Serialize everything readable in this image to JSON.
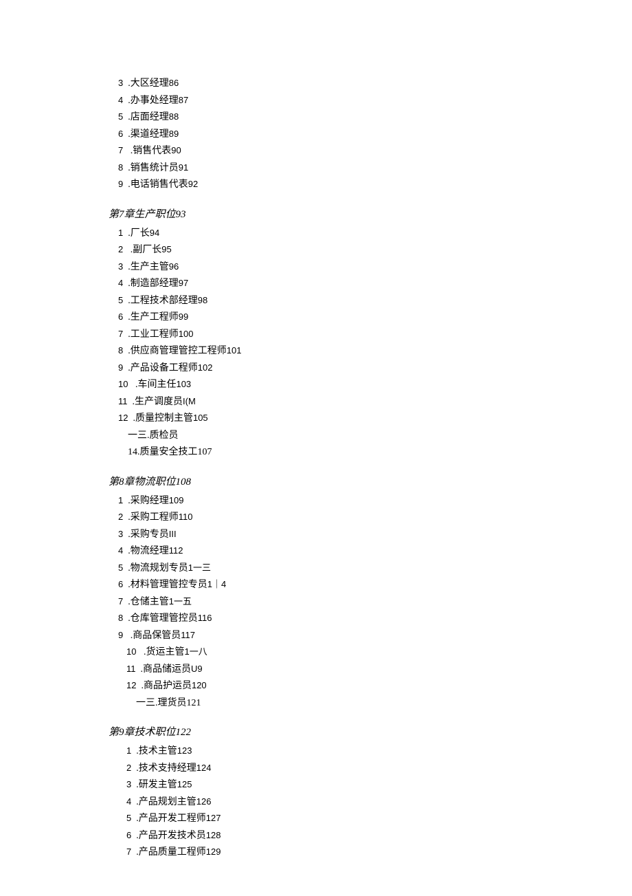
{
  "sections": [
    {
      "heading": null,
      "items": [
        {
          "num": "3",
          "sep": "  .",
          "text": "大区经理",
          "page": "86"
        },
        {
          "num": "4",
          "sep": "  .",
          "text": "办事处经理",
          "page": "87"
        },
        {
          "num": "5",
          "sep": "  .",
          "text": "店面经理",
          "page": "88"
        },
        {
          "num": "6",
          "sep": "  .",
          "text": "渠道经理",
          "page": "89"
        },
        {
          "num": "7",
          "sep": "   .",
          "text": "销售代表",
          "page": "90"
        },
        {
          "num": "8",
          "sep": "  .",
          "text": "销售统计员",
          "page": "91"
        },
        {
          "num": "9",
          "sep": "  .",
          "text": "电话销售代表",
          "page": "92"
        }
      ]
    },
    {
      "heading": {
        "prefix": "第",
        "num": "7",
        "title": "章生产职位",
        "page": "93"
      },
      "items": [
        {
          "num": "1",
          "sep": "  .",
          "text": "厂长",
          "page": "94"
        },
        {
          "num": "2",
          "sep": "   .",
          "text": "副厂长",
          "page": "95"
        },
        {
          "num": "3",
          "sep": "  .",
          "text": "生产主管",
          "page": "96"
        },
        {
          "num": "4",
          "sep": "  .",
          "text": "制造部经理",
          "page": "97"
        },
        {
          "num": "5",
          "sep": "  .",
          "text": "工程技术部经理",
          "page": "98"
        },
        {
          "num": "6",
          "sep": "  .",
          "text": "生产工程师",
          "page": "99"
        },
        {
          "num": "7",
          "sep": "  .",
          "text": "工业工程师",
          "page": "100"
        },
        {
          "num": "8",
          "sep": "  .",
          "text": "供应商管理管控工程师",
          "page": "101"
        },
        {
          "num": "9",
          "sep": "  .",
          "text": "产品设备工程师",
          "page": "102"
        },
        {
          "num": "10",
          "sep": "   .",
          "text": "车间主任",
          "page": "103"
        },
        {
          "num": "11",
          "sep": "  .",
          "text": "生产调度员",
          "page": "I(M"
        },
        {
          "num": "12",
          "sep": "  .",
          "text": "质量控制主管",
          "page": "105"
        },
        {
          "raw": "一三.质检员"
        },
        {
          "raw": "14.质量安全技工107"
        }
      ]
    },
    {
      "heading": {
        "prefix": "第",
        "num": "8",
        "title": "章物流职位",
        "page": "108"
      },
      "items": [
        {
          "num": "1",
          "sep": "  .",
          "text": "采购经理",
          "page": "109"
        },
        {
          "num": "2",
          "sep": "  .",
          "text": "采购工程师",
          "page": "110"
        },
        {
          "num": "3",
          "sep": "  .",
          "text": "采购专员",
          "page": "III"
        },
        {
          "num": "4",
          "sep": "  .",
          "text": "物流经理",
          "page": "112"
        },
        {
          "num": "5",
          "sep": "  .",
          "text": "物流规划专员",
          "page": "1一三"
        },
        {
          "num": "6",
          "sep": "  .",
          "text": "材料管理管控专员",
          "page": "1｜4"
        },
        {
          "num": "7",
          "sep": "  .",
          "text": "仓储主管",
          "page": "1一五"
        },
        {
          "num": "8",
          "sep": "  .",
          "text": "仓库管理管控员",
          "page": "116"
        },
        {
          "num": "9",
          "sep": "   .",
          "text": "商品保管员",
          "page": "117"
        }
      ],
      "items_indented": [
        {
          "num": "10",
          "sep": "   .",
          "text": "货运主管",
          "page": "1一八"
        },
        {
          "num": "11",
          "sep": "  .",
          "text": "商品储运员",
          "page": "U9"
        },
        {
          "num": "12",
          "sep": "  .",
          "text": "商品护运员",
          "page": "120"
        },
        {
          "raw": "一三.理货员121"
        }
      ]
    },
    {
      "heading": {
        "prefix": "第",
        "num": "9",
        "title": "章技术职位",
        "page": "122"
      },
      "indent": true,
      "items": [
        {
          "num": "1",
          "sep": "  .",
          "text": "技术主管",
          "page": "123"
        },
        {
          "num": "2",
          "sep": "  .",
          "text": "技术支持经理",
          "page": "124"
        },
        {
          "num": "3",
          "sep": "  .",
          "text": "研发主管",
          "page": "125"
        },
        {
          "num": "4",
          "sep": "  .",
          "text": "产品规划主管",
          "page": "126"
        },
        {
          "num": "5",
          "sep": "  .",
          "text": "产品开发工程师",
          "page": "127"
        },
        {
          "num": "6",
          "sep": "  .",
          "text": "产品开发技术员",
          "page": "128"
        },
        {
          "num": "7",
          "sep": "  .",
          "text": "产品质量工程师",
          "page": "129"
        }
      ]
    }
  ]
}
